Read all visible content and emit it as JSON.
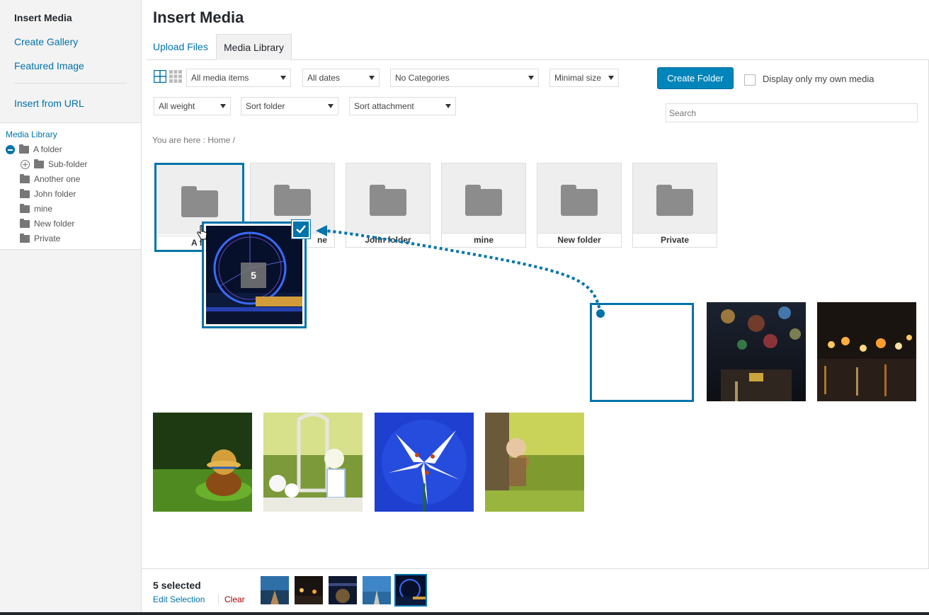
{
  "sidebar": {
    "menu": [
      {
        "label": "Insert Media",
        "active": true
      },
      {
        "label": "Create Gallery",
        "active": false
      },
      {
        "label": "Featured Image",
        "active": false
      },
      {
        "label": "Insert from URL",
        "active": false
      }
    ],
    "tree": {
      "root": "Media Library",
      "items": [
        "A folder",
        "Sub-folder",
        "Another one",
        "John folder",
        "mine",
        "New folder",
        "Private"
      ]
    }
  },
  "header": {
    "title": "Insert Media"
  },
  "tabs": [
    {
      "label": "Upload Files",
      "active": false
    },
    {
      "label": "Media Library",
      "active": true
    }
  ],
  "filters": {
    "media_type": "All media items",
    "dates": "All dates",
    "categories": "No Categories",
    "size": "Minimal size",
    "weight": "All weight",
    "sort_folder": "Sort folder",
    "sort_attachment": "Sort attachment"
  },
  "create_folder_label": "Create Folder",
  "own_media_label": "Display only my own media",
  "search": {
    "placeholder": "Search"
  },
  "breadcrumb": {
    "prefix": "You are here",
    "separator": ":",
    "home": "Home",
    "trail": "/"
  },
  "folders": [
    "A folder",
    "Another one",
    "John folder",
    "mine",
    "New folder",
    "Private"
  ],
  "folder_labels_visible": [
    "A fo",
    "ne",
    "John folder",
    "mine",
    "New folder",
    "Private"
  ],
  "drag": {
    "count": "5"
  },
  "selection": {
    "count_label": "5 selected",
    "edit_label": "Edit Selection",
    "clear_label": "Clear"
  },
  "colors": {
    "accent": "#0073aa",
    "primary_button": "#0085ba",
    "danger": "#a00000"
  }
}
